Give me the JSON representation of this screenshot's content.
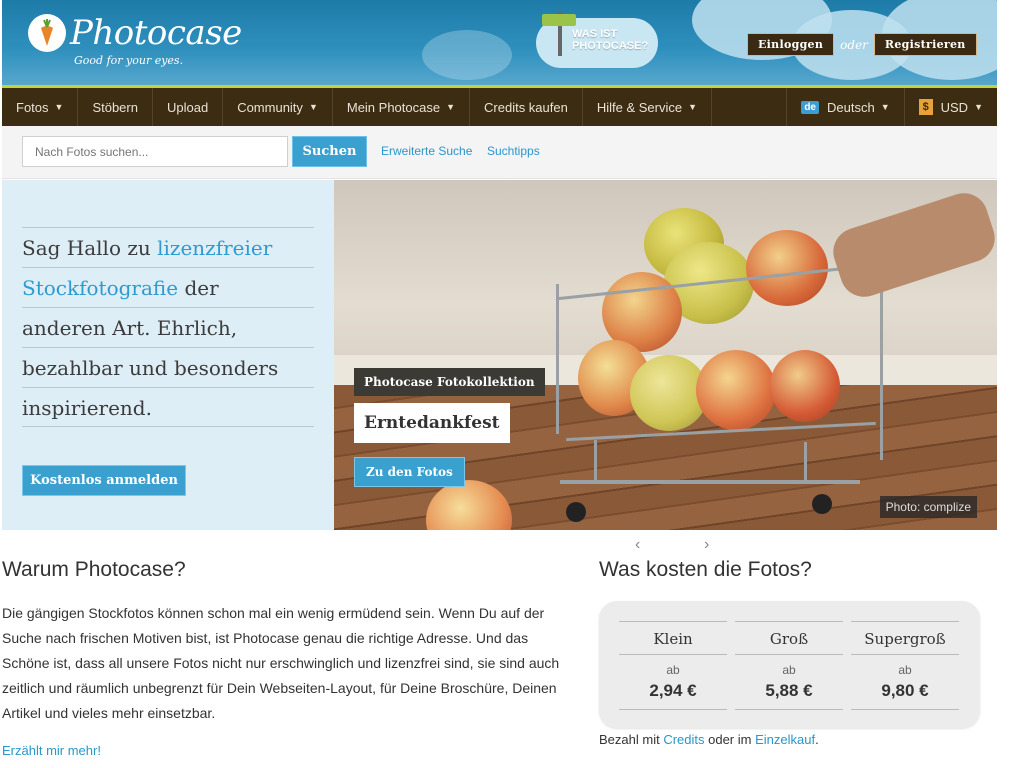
{
  "header": {
    "brand": "Photocase",
    "tagline": "Good for your eyes.",
    "what_is": [
      "WAS IST",
      "PHOTOCASE?"
    ],
    "login": "Einloggen",
    "or": "oder",
    "register": "Registrieren"
  },
  "nav": {
    "items": [
      "Fotos",
      "Stöbern",
      "Upload",
      "Community",
      "Mein Photocase",
      "Credits kaufen",
      "Hilfe & Service"
    ],
    "language_flag": "de",
    "language": "Deutsch",
    "currency_symbol": "$",
    "currency": "USD"
  },
  "search": {
    "placeholder": "Nach Fotos suchen...",
    "button": "Suchen",
    "advanced": "Erweiterte Suche",
    "tips": "Suchtipps"
  },
  "hero": {
    "line1_a": "Sag Hallo zu ",
    "line1_b": "lizenzfreier",
    "line2_a": "Stockfotografie",
    "line2_b": " der",
    "line3": "anderen Art. Ehrlich,",
    "line4": "bezahlbar und besonders",
    "line5": "inspirierend.",
    "register_button": "Kostenlos anmelden",
    "collection_tag": "Photocase Fotokollektion",
    "collection_title": "Erntedankfest",
    "to_photos": "Zu den Fotos",
    "photo_credit": "Photo: complize",
    "prev": "‹",
    "next": "›"
  },
  "why": {
    "title": "Warum Photocase?",
    "text": "Die gängigen Stockfotos können schon mal ein wenig ermüdend sein. Wenn Du auf der Suche nach frischen Motiven bist, ist Photocase genau die richtige Adresse. Und das Schöne ist, dass all unsere Fotos nicht nur erschwinglich und lizenzfrei sind, sie sind auch zeitlich und räumlich unbegrenzt für Dein Webseiten-Layout, für Deine Broschüre, Deinen Artikel und vieles mehr einsetzbar.",
    "more": "Erzählt mir mehr!"
  },
  "pricing": {
    "title": "Was kosten die Fotos?",
    "sizes": [
      {
        "name": "Klein",
        "ab": "ab",
        "price": "2,94 €"
      },
      {
        "name": "Groß",
        "ab": "ab",
        "price": "5,88 €"
      },
      {
        "name": "Supergroß",
        "ab": "ab",
        "price": "9,80 €"
      }
    ],
    "footer_a": "Bezahl mit ",
    "footer_credits": "Credits",
    "footer_b": " oder im ",
    "footer_single": "Einzelkauf",
    "footer_c": "."
  },
  "colors": {
    "accent": "#3aa0cf",
    "nav_bg": "#3c2c12",
    "header_blue": "#2e8fbd",
    "hero_panel": "#deeef7"
  }
}
